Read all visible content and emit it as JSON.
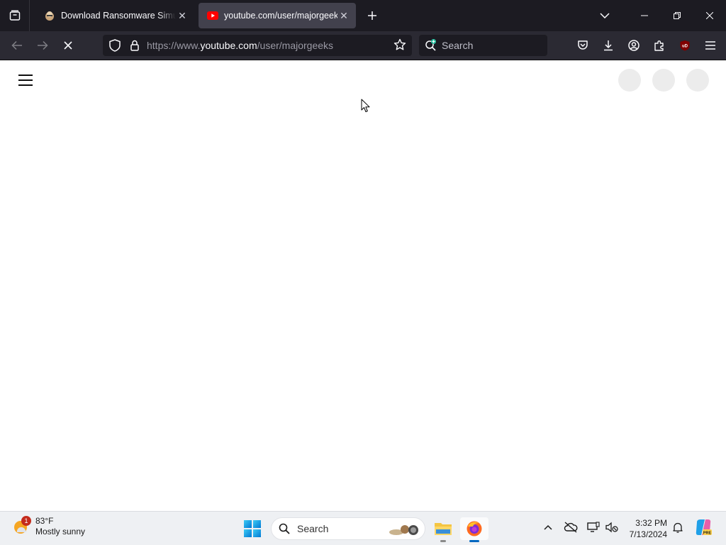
{
  "browser": {
    "tabs": [
      {
        "title": "Download Ransomware Simulator",
        "active": false,
        "favicon": "majorgeeks-favicon"
      },
      {
        "title": "youtube.com/user/majorgeeks",
        "active": true,
        "favicon": "youtube-favicon"
      }
    ],
    "url": {
      "prefix": "https://www.",
      "host": "youtube.com",
      "path": "/user/majorgeeks"
    },
    "search_placeholder": "Search",
    "colors": {
      "tab_bar": "#1c1b22",
      "toolbar": "#2b2a33",
      "active_tab": "#42414d"
    }
  },
  "taskbar": {
    "weather": {
      "badge": "1",
      "temperature": "83°F",
      "condition": "Mostly sunny"
    },
    "search_placeholder": "Search",
    "clock": {
      "time": "3:32 PM",
      "date": "7/13/2024"
    }
  }
}
